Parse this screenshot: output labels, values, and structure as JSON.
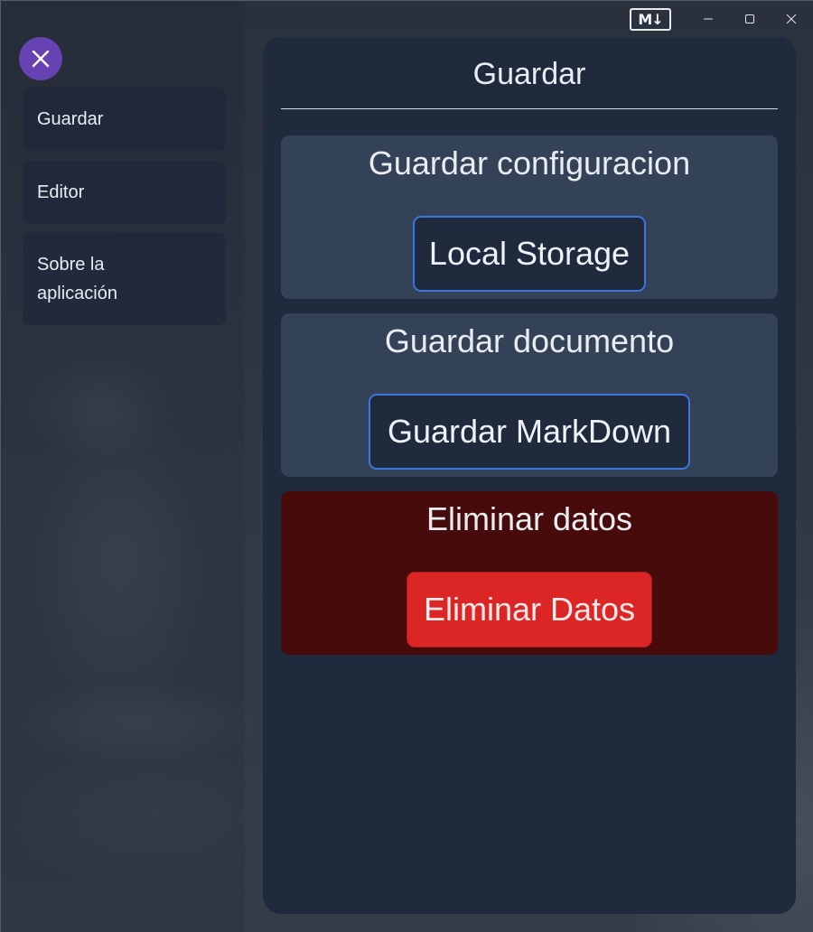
{
  "window": {
    "logo_text": "M↓",
    "controls": [
      "minimize",
      "maximize",
      "close"
    ]
  },
  "sidebar": {
    "close_icon": "close-icon",
    "items": [
      {
        "label": "Guardar"
      },
      {
        "label": "Editor"
      },
      {
        "label": "Sobre la aplicación"
      }
    ]
  },
  "main": {
    "title": "Guardar",
    "sections": [
      {
        "title": "Guardar configuracion",
        "button_label": "Local Storage"
      },
      {
        "title": "Guardar documento",
        "button_label": "Guardar MarkDown"
      },
      {
        "title": "Eliminar datos",
        "button_label": "Eliminar Datos"
      }
    ]
  },
  "colors": {
    "accent_purple": "#6742b3",
    "panel_bg": "#1f2a3c",
    "card_bg": "#334256",
    "danger_card_bg": "#470b0b",
    "danger_button": "#dc2626",
    "button_border": "#3b76e0"
  }
}
